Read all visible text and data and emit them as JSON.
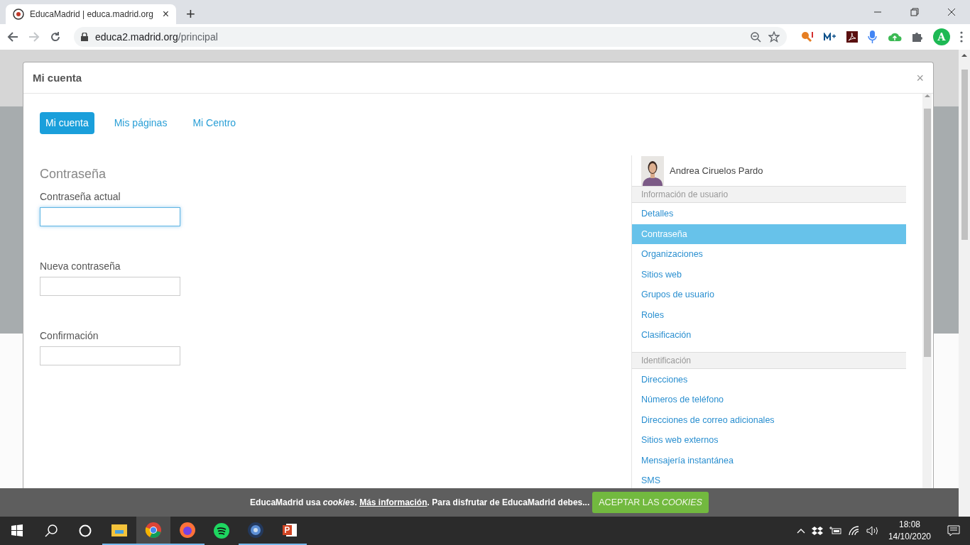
{
  "browser": {
    "tab": {
      "title": "EducaMadrid | educa.madrid.org",
      "close": "×"
    },
    "new_tab": "+",
    "address": {
      "host": "educa2.madrid.org",
      "path": "/principal"
    },
    "forward_disabled": true,
    "profile_initial": "A"
  },
  "modal": {
    "title": "Mi cuenta",
    "close": "×",
    "tabs": [
      {
        "label": "Mi cuenta",
        "selected": true
      },
      {
        "label": "Mis páginas",
        "selected": false
      },
      {
        "label": "Mi Centro",
        "selected": false
      }
    ],
    "form": {
      "heading": "Contraseña",
      "fields": [
        {
          "label": "Contraseña actual",
          "focused": true
        },
        {
          "label": "Nueva contraseña",
          "focused": false
        },
        {
          "label": "Confirmación",
          "focused": false
        }
      ]
    },
    "user": {
      "name": "Andrea Ciruelos Pardo"
    },
    "nav": [
      {
        "header": "Información de usuario",
        "items": [
          {
            "label": "Detalles",
            "selected": false
          },
          {
            "label": "Contraseña",
            "selected": true
          },
          {
            "label": "Organizaciones",
            "selected": false
          },
          {
            "label": "Sitios web",
            "selected": false
          },
          {
            "label": "Grupos de usuario",
            "selected": false
          },
          {
            "label": "Roles",
            "selected": false
          },
          {
            "label": "Clasificación",
            "selected": false
          }
        ]
      },
      {
        "header": "Identificación",
        "items": [
          {
            "label": "Direcciones",
            "selected": false
          },
          {
            "label": "Números de teléfono",
            "selected": false
          },
          {
            "label": "Direcciones de correo adicionales",
            "selected": false
          },
          {
            "label": "Sitios web externos",
            "selected": false
          },
          {
            "label": "Mensajería instantánea",
            "selected": false
          },
          {
            "label": "SMS",
            "selected": false
          }
        ]
      }
    ]
  },
  "cookie_bar": {
    "before": "EducaMadrid usa *cookies*.",
    "link": "Más información",
    "after": ". Para disfrutar de EducaMadrid debes...",
    "button": "ACEPTAR LAS *COOKIES*"
  },
  "taskbar": {
    "apps": [
      {
        "kind": "explorer",
        "running": true,
        "selected": false
      },
      {
        "kind": "chrome",
        "running": true,
        "selected": true
      },
      {
        "kind": "firefox",
        "running": true,
        "selected": false
      },
      {
        "kind": "spotify",
        "running": false,
        "selected": false
      },
      {
        "kind": "globe",
        "running": true,
        "selected": false
      },
      {
        "kind": "slides",
        "running": true,
        "selected": false
      }
    ],
    "time": "18:08",
    "date": "14/10/2020"
  }
}
